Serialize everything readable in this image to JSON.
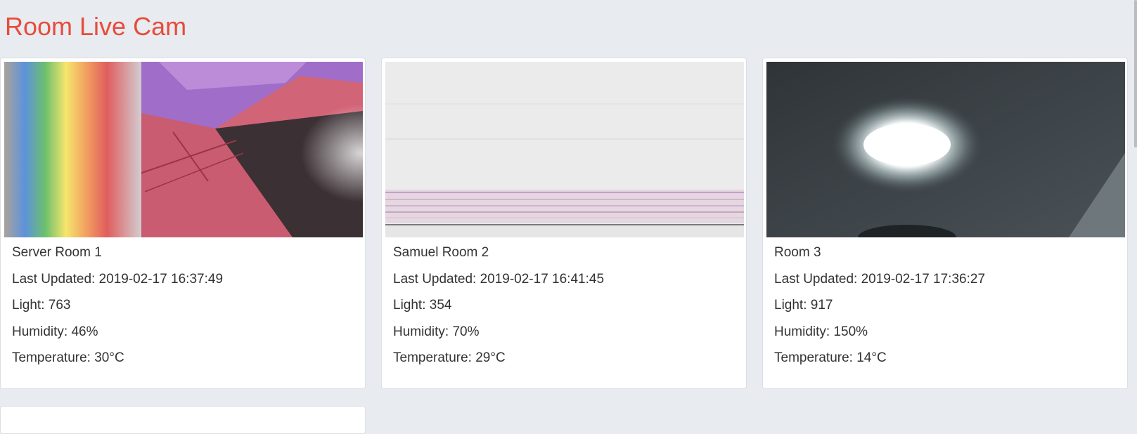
{
  "page": {
    "title": "Room Live Cam"
  },
  "cameras": [
    {
      "name": "Server Room 1",
      "last_updated": "Last Updated: 2019-02-17 16:37:49",
      "light": "Light: 763",
      "humidity": "Humidity: 46%",
      "temperature": "Temperature: 30°C"
    },
    {
      "name": "Samuel Room 2",
      "last_updated": "Last Updated: 2019-02-17 16:41:45",
      "light": "Light: 354",
      "humidity": "Humidity: 70%",
      "temperature": "Temperature: 29°C"
    },
    {
      "name": "Room 3",
      "last_updated": "Last Updated: 2019-02-17 17:36:27",
      "light": "Light: 917",
      "humidity": "Humidity: 150%",
      "temperature": "Temperature: 14°C"
    }
  ],
  "colors": {
    "title": "#e74c3c",
    "background": "#e8ebef",
    "card": "#ffffff"
  }
}
